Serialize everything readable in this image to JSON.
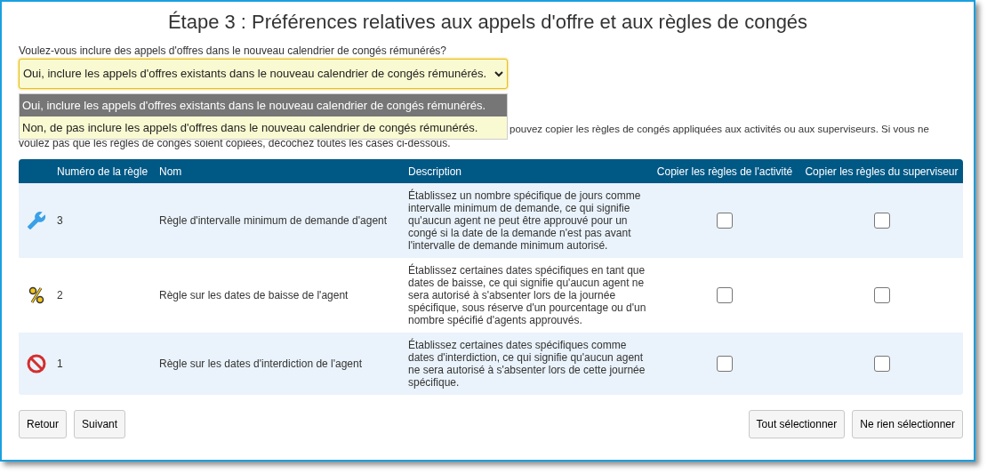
{
  "title": "Étape 3 : Préférences relatives aux appels d'offre et aux règles de congés",
  "question": {
    "label": "Voulez-vous inclure des appels d'offres dans le nouveau calendrier de congés rémunérés?",
    "value": "Oui, inclure les appels d'offres existants dans le nouveau calendrier de congés rémunérés.",
    "options": [
      {
        "label": "Oui, inclure les appels d'offres existants dans le nouveau calendrier de congés rémunérés.",
        "selected": true
      },
      {
        "label": "Non, de pas inclure les appels d'offres dans le nouveau calendrier de congés rémunérés.",
        "selected": false
      }
    ]
  },
  "instructions": [
    "pouvez copier les règles de congés appliquées aux activités ou aux superviseurs. Si vous ne",
    "voulez pas que les règles de congés soient copiées, décochez toutes les cases ci-dessous."
  ],
  "table": {
    "columns": [
      "Numéro de la règle",
      "Nom",
      "Description",
      "Copier les règles de l'activité",
      "Copier les règles du superviseur"
    ],
    "rows": [
      {
        "kind": "wrench",
        "number": "3",
        "name": "Règle d'intervalle minimum de demande d'agent",
        "description": "Établissez un nombre spécifique de jours comme intervalle minimum de demande, ce qui signifie qu'aucun agent ne peut être approuvé pour un congé si la date de la demande n'est pas avant l'intervalle de demande minimum autorisé.",
        "copy_activity": false,
        "copy_supervisor": false
      },
      {
        "kind": "percent",
        "number": "2",
        "name": "Règle sur les dates de baisse de l'agent",
        "description": "Établissez certaines dates spécifiques en tant que dates de baisse, ce qui signifie qu'aucun agent ne sera autorisé à s'absenter lors de la journée spécifique, sous réserve d'un pourcentage ou d'un nombre spécifié d'agents approuvés.",
        "copy_activity": false,
        "copy_supervisor": false
      },
      {
        "kind": "blocked",
        "number": "1",
        "name": "Règle sur les dates d'interdiction de l'agent",
        "description": "Établissez certaines dates spécifiques comme dates d'interdiction, ce qui signifie qu'aucun agent ne sera autorisé à s'absenter lors de cette journée spécifique.",
        "copy_activity": false,
        "copy_supervisor": false
      }
    ]
  },
  "buttons_left": [
    "Retour",
    "Suivant"
  ],
  "buttons_right": [
    "Tout sélectionner",
    "Ne rien sélectionner"
  ]
}
